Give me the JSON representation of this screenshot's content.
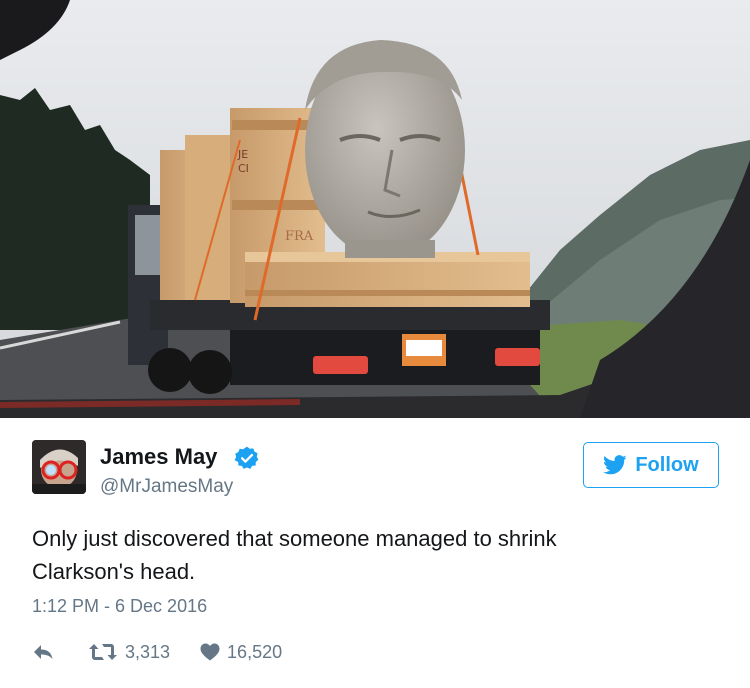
{
  "tweet": {
    "display_name": "James May",
    "handle": "@MrJamesMay",
    "verified_icon": "verified-badge-icon",
    "follow_label": "Follow",
    "text_line1": "Only just discovered that someone managed to shrink",
    "text_line2": "Clarkson's head.",
    "timestamp": "1:12 PM - 6 Dec 2016",
    "retweets": "3,313",
    "likes": "16,520",
    "photo_signs": {
      "crate_top": "JE",
      "crate_mid": "CI",
      "crate_stencil": "FRA"
    }
  },
  "colors": {
    "brand_blue": "#1da1f2",
    "text": "#14171a",
    "muted": "#657786"
  },
  "icons": [
    "reply-icon",
    "retweet-icon",
    "heart-icon",
    "twitter-bird-icon"
  ]
}
